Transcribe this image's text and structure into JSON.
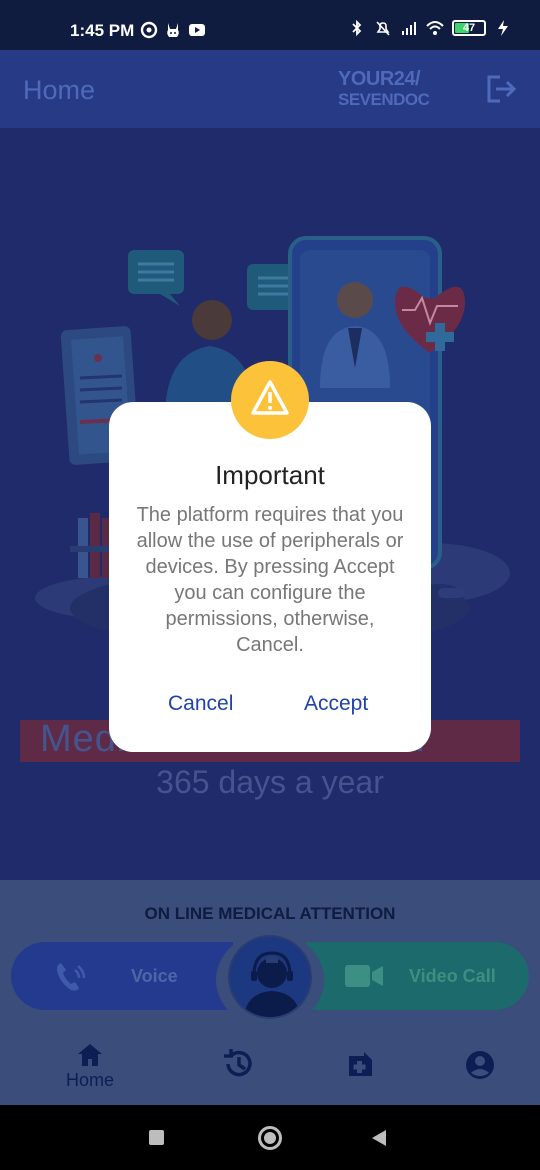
{
  "status_bar": {
    "time": "1:45 PM",
    "battery_level": "47",
    "icons": [
      "signal-icon-app",
      "rabbit-icon",
      "youtube-icon",
      "bluetooth-icon",
      "mute-icon",
      "cell-signal-icon",
      "wifi-icon",
      "battery-icon",
      "charging-icon"
    ]
  },
  "app_bar": {
    "title": "Home",
    "logo_line1": "YOUR24/",
    "logo_line2": "SEVENDOC",
    "logout_icon": "logout-icon"
  },
  "main": {
    "banner_text": "Medical attention 24/7",
    "subtitle": "365 days a year"
  },
  "attention": {
    "title": "ON LINE MEDICAL ATTENTION",
    "voice_label": "Voice",
    "video_label": "Video Call"
  },
  "bottom_nav": {
    "items": [
      {
        "label": "Home",
        "icon": "home-icon"
      },
      {
        "label": "",
        "icon": "history-icon"
      },
      {
        "label": "",
        "icon": "medical-record-icon"
      },
      {
        "label": "",
        "icon": "account-icon"
      }
    ]
  },
  "dialog": {
    "title": "Important",
    "message": "The platform requires that you allow the use of peripherals or devices. By pressing Accept you can configure the permissions, otherwise, Cancel.",
    "cancel_label": "Cancel",
    "accept_label": "Accept",
    "icon": "warning-icon"
  },
  "colors": {
    "overlay_app_bar": "#273a86",
    "dialog_bg": "#ffffff",
    "warning_badge": "#fcc23a",
    "dialog_button_text": "#1f43a8",
    "voice_button": "#243a8e",
    "video_button": "#1c6a6b"
  }
}
